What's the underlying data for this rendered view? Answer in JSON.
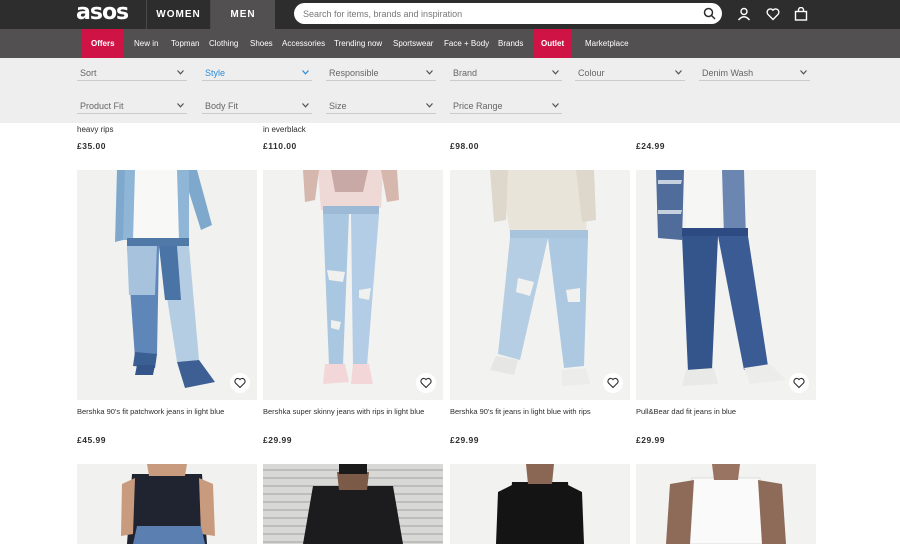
{
  "header": {
    "logo": "asos",
    "women_label": "WOMEN",
    "men_label": "MEN",
    "search_placeholder": "Search for items, brands and inspiration",
    "icons": [
      "search-icon",
      "account-icon",
      "saved-items-icon",
      "bag-icon"
    ]
  },
  "nav": {
    "items": [
      "Offers",
      "New in",
      "Topman",
      "Clothing",
      "Shoes",
      "Accessories",
      "Trending now",
      "Sportswear",
      "Face + Body",
      "Brands",
      "Outlet",
      "Marketplace"
    ],
    "accent": "#d01345"
  },
  "filters": {
    "row1": [
      "Sort",
      "Style",
      "Responsible",
      "Brand",
      "Colour",
      "Denim Wash"
    ],
    "row2": [
      "Product Fit",
      "Body Fit",
      "Size",
      "Price Range"
    ],
    "active": "Style",
    "active_color": "#2d8cd8"
  },
  "previous_row": {
    "captions": [
      "heavy rips",
      "in everblack",
      "",
      ""
    ],
    "prices": [
      "£35.00",
      "£110.00",
      "£98.00",
      "£24.99"
    ]
  },
  "products": [
    {
      "name": "Bershka 90's fit patchwork jeans in light blue",
      "price": "£45.99"
    },
    {
      "name": "Bershka super skinny jeans with rips in light blue",
      "price": "£29.99"
    },
    {
      "name": "Bershka 90's fit jeans in light blue with rips",
      "price": "£29.99"
    },
    {
      "name": "Pull&Bear dad fit jeans in blue",
      "price": "£29.99"
    }
  ]
}
